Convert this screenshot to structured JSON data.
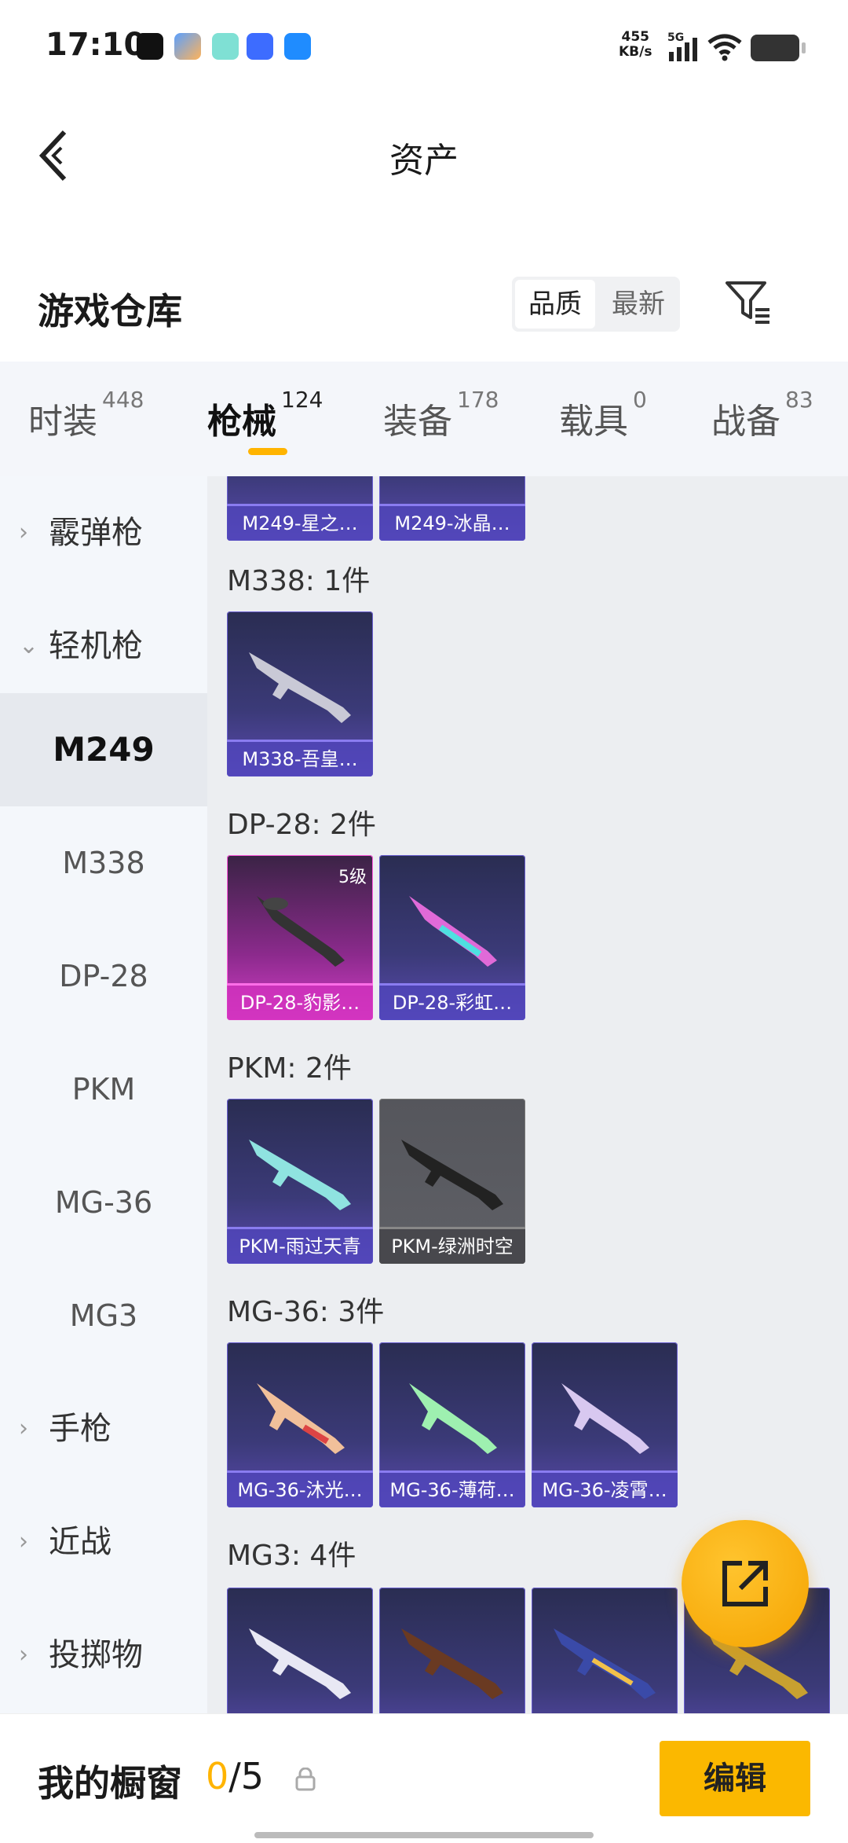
{
  "status": {
    "time": "17:10",
    "net_speed_value": "455",
    "net_speed_unit": "KB/s",
    "network": "5G"
  },
  "header": {
    "title": "资产"
  },
  "warehouse": {
    "title": "游戏仓库",
    "sort_quality": "品质",
    "sort_newest": "最新"
  },
  "tabs": [
    {
      "label": "时装",
      "count": "448"
    },
    {
      "label": "枪械",
      "count": "124"
    },
    {
      "label": "装备",
      "count": "178"
    },
    {
      "label": "载具",
      "count": "0"
    },
    {
      "label": "战备",
      "count": "83"
    }
  ],
  "sidebar": {
    "shotgun": "霰弹枪",
    "lmg": "轻机枪",
    "items": [
      "M249",
      "M338",
      "DP-28",
      "PKM",
      "MG-36",
      "MG3"
    ],
    "pistol": "手枪",
    "melee": "近战",
    "throwable": "投掷物"
  },
  "sections": {
    "m249_cards": [
      "M249-星之…",
      "M249-冰晶…"
    ],
    "m338": {
      "title": "M338: 1件",
      "cards": [
        "M338-吾皇…"
      ]
    },
    "dp28": {
      "title": "DP-28: 2件",
      "cards": [
        "DP-28-豹影…",
        "DP-28-彩虹…"
      ],
      "level": "5级"
    },
    "pkm": {
      "title": "PKM: 2件",
      "cards": [
        "PKM-雨过天青",
        "PKM-绿洲时空"
      ]
    },
    "mg36": {
      "title": "MG-36: 3件",
      "cards": [
        "MG-36-沐光…",
        "MG-36-薄荷…",
        "MG-36-凌霄…"
      ]
    },
    "mg3": {
      "title": "MG3: 4件"
    }
  },
  "bottom": {
    "label": "我的橱窗",
    "current": "0",
    "total": "/5",
    "edit": "编辑"
  },
  "colors": {
    "accent": "#ffb400",
    "card_purple": "#3b3a78",
    "card_pink": "#d33ec7"
  }
}
